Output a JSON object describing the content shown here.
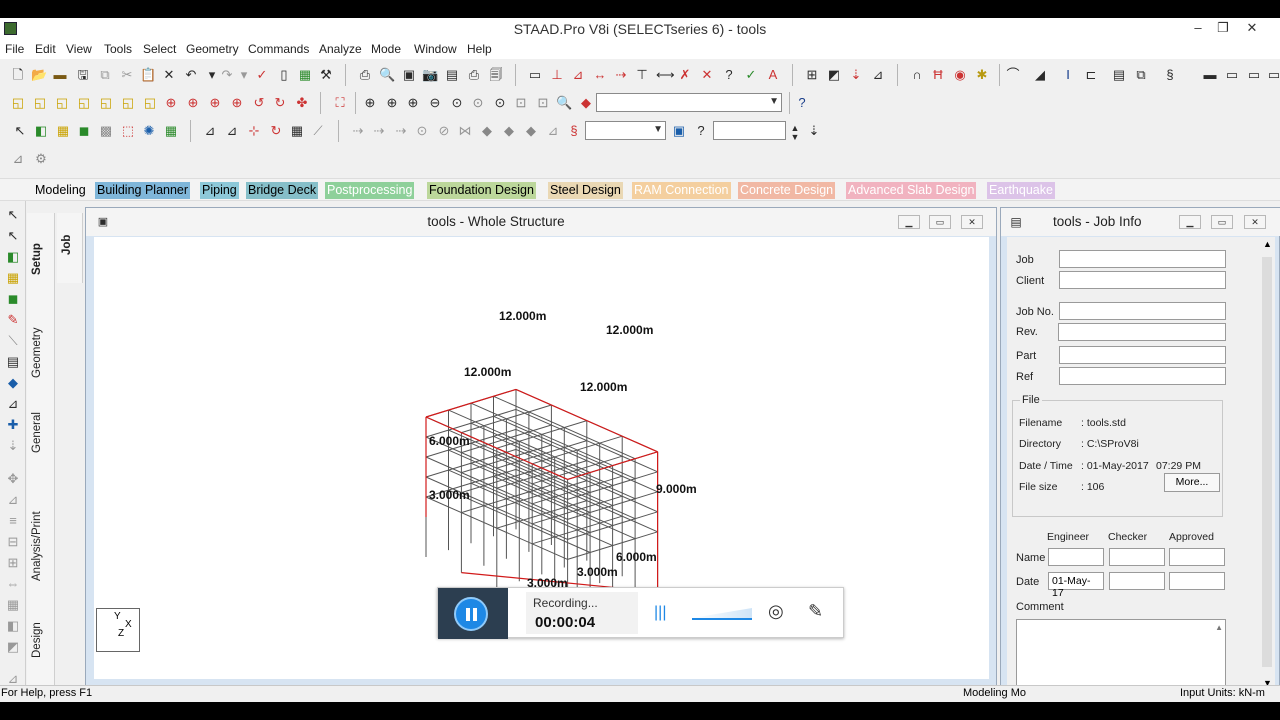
{
  "app": {
    "title": "STAAD.Pro V8i (SELECTseries 6) - tools"
  },
  "window_controls": {
    "minimize": "–",
    "restore": "❐",
    "close": "✕"
  },
  "menu": [
    "File",
    "Edit",
    "View",
    "Tools",
    "Select",
    "Geometry",
    "Commands",
    "Analyze",
    "Mode",
    "Window",
    "Help"
  ],
  "page_tabs": [
    {
      "label": "Modeling",
      "color": "#f3f3f3"
    },
    {
      "label": "Building Planner",
      "color": "#7fb6d9"
    },
    {
      "label": "Piping",
      "color": "#8dc8d8"
    },
    {
      "label": "Bridge Deck",
      "color": "#86bfc9"
    },
    {
      "label": "Postprocessing",
      "color": "#8ed09a"
    },
    {
      "label": "Foundation Design",
      "color": "#bcd79b"
    },
    {
      "label": "Steel Design",
      "color": "#ead8b4"
    },
    {
      "label": "RAM Connection",
      "color": "#f4cf9f"
    },
    {
      "label": "Concrete Design",
      "color": "#f1b8a4"
    },
    {
      "label": "Advanced Slab Design",
      "color": "#f1b3c0"
    },
    {
      "label": "Earthquake",
      "color": "#dcc3e8"
    }
  ],
  "side_tabs": {
    "job": "Job",
    "setup": "Setup",
    "geometry": "Geometry",
    "general": "General",
    "analysis": "Analysis/Print",
    "design": "Design"
  },
  "structure_window": {
    "title": "tools - Whole Structure",
    "dimensions": {
      "top_back": "12.000m",
      "top_right": "12.000m",
      "top_mid_left": "12.000m",
      "top_mid_right": "12.000m",
      "height_upper": "6.000m",
      "height_lower": "3.000m",
      "height_total": "9.000m",
      "base_right": "6.000m",
      "base_mid": "3.000m",
      "base_left": "3.000m"
    },
    "axis": {
      "y": "Y",
      "x": "X",
      "z": "Z"
    }
  },
  "job_info": {
    "title": "tools - Job Info",
    "labels": {
      "job": "Job",
      "client": "Client",
      "job_no": "Job No.",
      "rev": "Rev.",
      "part": "Part",
      "ref": "Ref",
      "file_group": "File",
      "filename": "Filename",
      "directory": "Directory",
      "date_time": "Date / Time",
      "file_size": "File size",
      "engineer": "Engineer",
      "checker": "Checker",
      "approved": "Approved",
      "name": "Name",
      "date": "Date",
      "comment": "Comment"
    },
    "values": {
      "filename": ": tools.std",
      "directory": ": C:\\SProV8i",
      "date": ": 01-May-2017",
      "time": "07:29 PM",
      "file_size": ": 106",
      "engineer_date": "01-May-17"
    },
    "more_button": "More..."
  },
  "recorder": {
    "status": "Recording...",
    "elapsed": "00:00:04"
  },
  "status_bar": {
    "help": "For Help, press F1",
    "mode": "Modeling Mo",
    "units": "Input Units:  kN-m"
  }
}
